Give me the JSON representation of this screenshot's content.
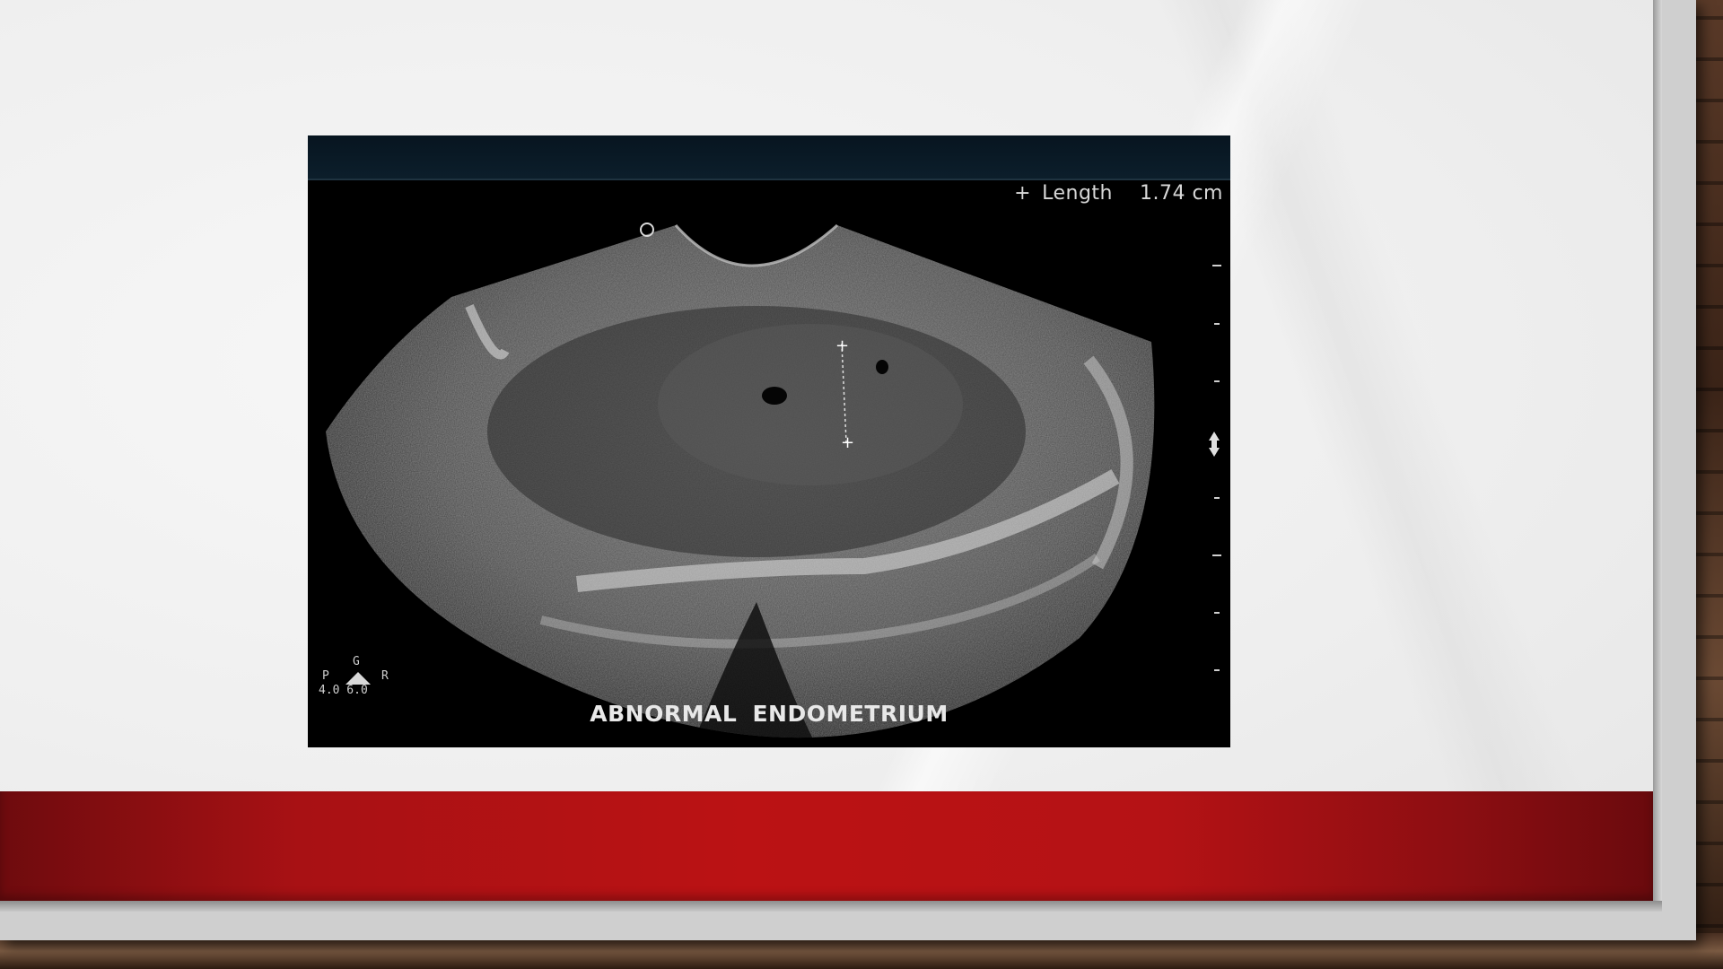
{
  "ultrasound": {
    "measurement_label": "Length",
    "measurement_value": "1.74 cm",
    "plus_glyph": "+",
    "caption": "ABNORMAL ENDOMETRIUM",
    "probe": {
      "g": "G",
      "p": "P",
      "r": "R",
      "values": "4.0 6.0"
    }
  },
  "colors": {
    "band_red": "#bb1214",
    "slide_bg": "#efefef"
  }
}
